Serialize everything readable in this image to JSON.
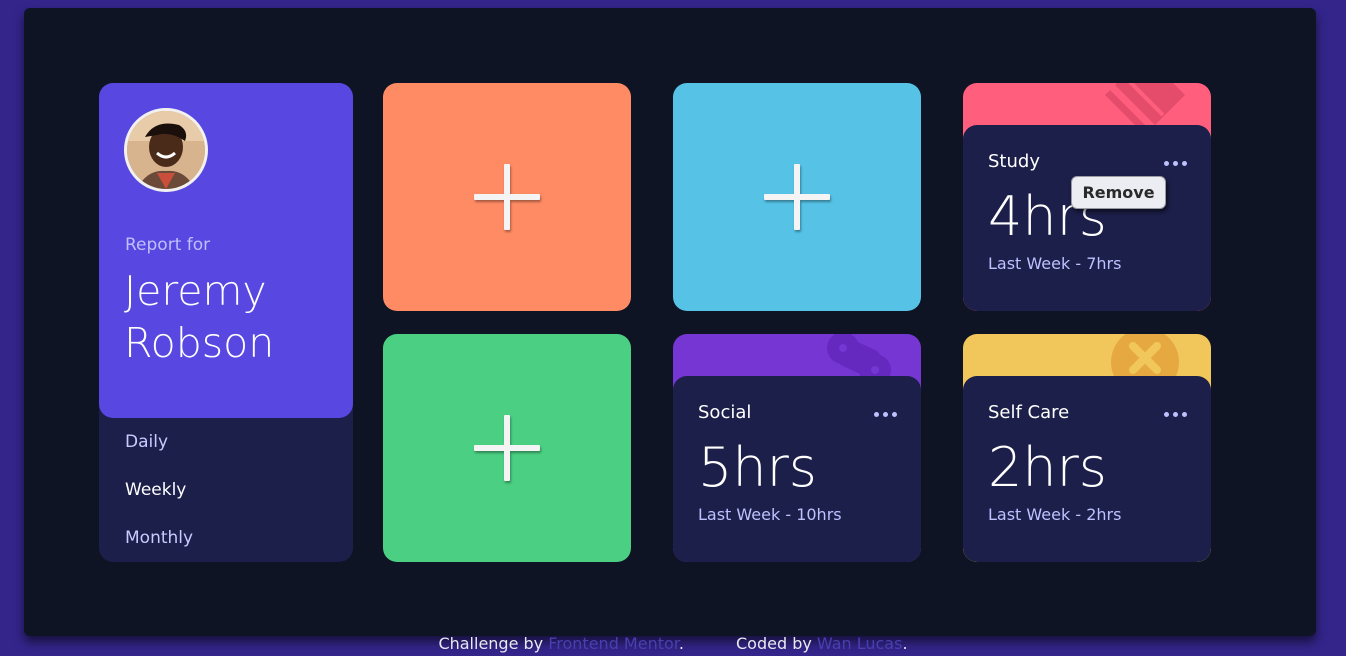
{
  "profile": {
    "report_for": "Report for",
    "name_line1": "Jeremy",
    "name_line2": "Robson",
    "periods": [
      "Daily",
      "Weekly",
      "Monthly"
    ],
    "active_period": "Weekly"
  },
  "add_cards": [
    {
      "color": "#ff8b64",
      "icon": "plus-icon"
    },
    {
      "color": "#55c2e6",
      "icon": "plus-icon"
    },
    {
      "color": "#4bcf82",
      "icon": "plus-icon"
    }
  ],
  "activities": [
    {
      "title": "Study",
      "current": "4hrs",
      "previous": "Last Week - 7hrs",
      "color": "#ff5e7d",
      "icon": "book-icon"
    },
    {
      "title": "Social",
      "current": "5hrs",
      "previous": "Last Week - 10hrs",
      "color": "#7536d3",
      "icon": "social-icon"
    },
    {
      "title": "Self Care",
      "current": "2hrs",
      "previous": "Last Week - 2hrs",
      "color": "#f1c75b",
      "icon": "heart-icon"
    }
  ],
  "context_menu": {
    "remove_label": "Remove"
  },
  "footer": {
    "challenge_prefix": "Challenge by ",
    "challenge_link": "Frontend Mentor",
    "challenge_suffix": ".",
    "coded_prefix": "Coded by ",
    "coded_link": "Wan Lucas",
    "coded_suffix": "."
  },
  "colors": {
    "background": "#33258a",
    "panel": "#0f1424",
    "card": "#1c1f4a",
    "profile_accent": "#5847e0"
  }
}
